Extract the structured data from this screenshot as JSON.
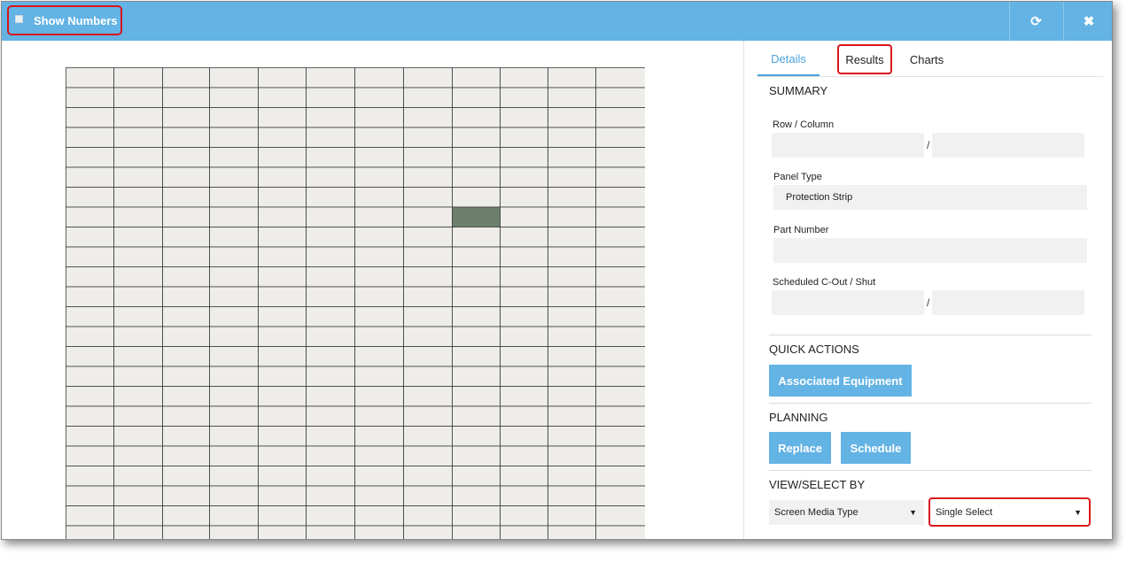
{
  "titlebar": {
    "show_numbers_label": "Show Numbers",
    "checkbox_icon": "checkbox-icon",
    "refresh_icon": "refresh-icon",
    "close_icon": "close-icon",
    "refresh_glyph": "⟳",
    "close_glyph": "✖",
    "color": "#63b3e4"
  },
  "grid": {
    "rows": 24,
    "cols": 12,
    "cell_fill": "#eeede9",
    "line_color": "#3b3b3b",
    "selected_cell": {
      "row": 7,
      "col": 8,
      "fill": "#6e7f6e"
    }
  },
  "tabs": [
    {
      "label": "Details",
      "active": true
    },
    {
      "label": "Results",
      "active": false
    },
    {
      "label": "Charts",
      "active": false
    }
  ],
  "summary": {
    "title": "SUMMARY",
    "row_column_label": "Row / Column",
    "row_value": "",
    "column_value": "",
    "separator": "/",
    "panel_type_label": "Panel Type",
    "panel_type_value": "Protection Strip",
    "part_number_label": "Part Number",
    "part_number_value": "",
    "scheduled_label": "Scheduled C-Out / Shut",
    "scheduled_cout_value": "",
    "scheduled_shut_value": ""
  },
  "quick_actions": {
    "title": "QUICK ACTIONS",
    "associated_equipment_label": "Associated Equipment"
  },
  "planning": {
    "title": "PLANNING",
    "replace_label": "Replace",
    "schedule_label": "Schedule"
  },
  "view_select": {
    "title": "VIEW/SELECT BY",
    "view_value": "Screen Media Type",
    "select_value": "Single Select",
    "arrow_glyph": "▼"
  },
  "colors": {
    "accent": "#63b3e4",
    "highlight_outline": "#d9141c"
  }
}
